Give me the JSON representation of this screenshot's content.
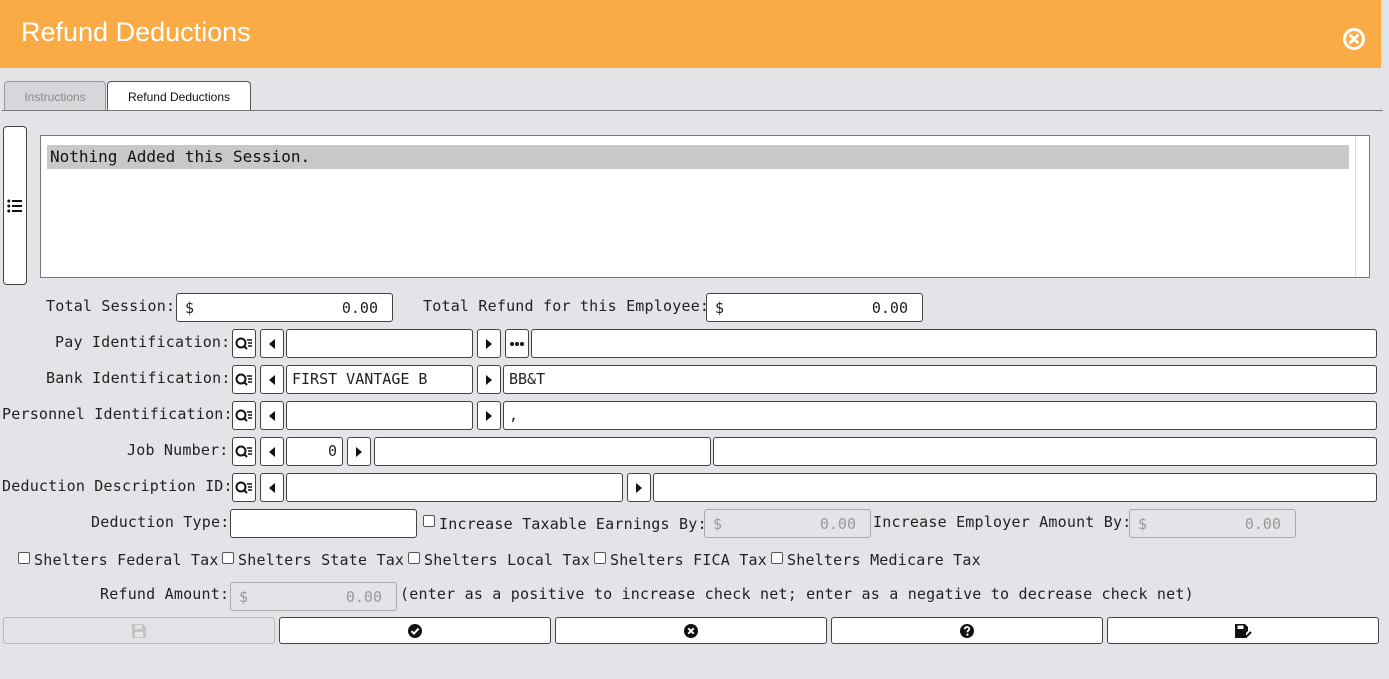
{
  "header": {
    "title": "Refund Deductions"
  },
  "tabs": [
    {
      "label": "Instructions",
      "active": false
    },
    {
      "label": "Refund Deductions",
      "active": true
    }
  ],
  "list": {
    "rows": [
      "Nothing Added this Session."
    ]
  },
  "totals": {
    "session_label": "Total Session:",
    "session_currency": "$",
    "session_value": "0.00",
    "employee_label": "Total Refund for this Employee:",
    "employee_currency": "$",
    "employee_value": "0.00"
  },
  "pay_id": {
    "label": "Pay Identification:",
    "value": "",
    "description": ""
  },
  "bank_id": {
    "label": "Bank Identification:",
    "value": "FIRST VANTAGE B",
    "description": "BB&T"
  },
  "personnel_id": {
    "label": "Personnel Identification:",
    "value": "",
    "description": ","
  },
  "job": {
    "label": "Job Number:",
    "value": "0",
    "description1": "",
    "description2": ""
  },
  "deduction_desc": {
    "label": "Deduction Description ID:",
    "value": "",
    "description": ""
  },
  "deduction_type": {
    "label": "Deduction Type:",
    "value": "",
    "increase_taxable_label": "Increase Taxable Earnings By:",
    "increase_taxable_checked": false,
    "increase_taxable_currency": "$",
    "increase_taxable_value": "0.00",
    "increase_employer_label": "Increase Employer Amount By:",
    "increase_employer_currency": "$",
    "increase_employer_value": "0.00"
  },
  "shelters": [
    {
      "label": "Shelters Federal Tax",
      "checked": false
    },
    {
      "label": "Shelters State Tax",
      "checked": false
    },
    {
      "label": "Shelters Local Tax",
      "checked": false
    },
    {
      "label": "Shelters FICA Tax",
      "checked": false
    },
    {
      "label": "Shelters Medicare Tax",
      "checked": false
    }
  ],
  "refund": {
    "label": "Refund Amount:",
    "currency": "$",
    "value": "0.00",
    "note": "(enter as a positive to increase check net; enter as a negative to decrease check net)"
  },
  "buttons": [
    {
      "icon": "save-icon",
      "enabled": false
    },
    {
      "icon": "check-circle-icon",
      "enabled": true
    },
    {
      "icon": "cancel-circle-icon",
      "enabled": true
    },
    {
      "icon": "help-circle-icon",
      "enabled": true
    },
    {
      "icon": "save-check-icon",
      "enabled": true
    }
  ],
  "colors": {
    "header": "#fbab45",
    "background": "#e4e3e8"
  }
}
